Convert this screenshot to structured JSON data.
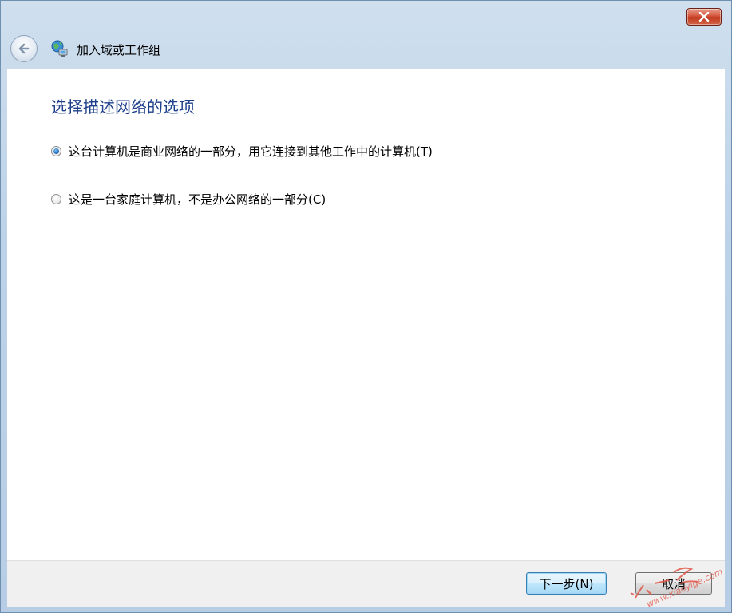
{
  "window": {
    "title": "加入域或工作组"
  },
  "titlebar": {
    "close_icon": "close-icon"
  },
  "nav": {
    "back_icon": "back-arrow-icon",
    "wizard_icon": "network-globe-icon"
  },
  "main": {
    "heading": "选择描述网络的选项",
    "options": [
      {
        "label": "这台计算机是商业网络的一部分，用它连接到其他工作中的计算机(T)",
        "checked": true
      },
      {
        "label": "这是一台家庭计算机，不是办公网络的一部分(C)",
        "checked": false
      }
    ]
  },
  "footer": {
    "next_label": "下一步(N)",
    "cancel_label": "取消"
  },
  "watermark": {
    "text": "小一哥 www.xiaoyige.com"
  },
  "colors": {
    "heading": "#1e3f8b",
    "frame": "#bcd2e8",
    "close": "#c23b20",
    "watermark": "#e0584a"
  }
}
